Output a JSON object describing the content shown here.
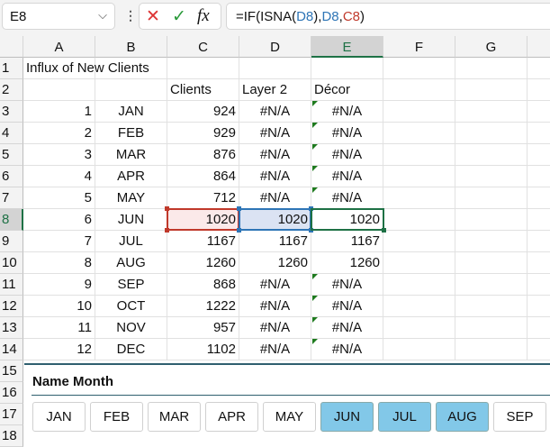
{
  "name_box": "E8",
  "formula": {
    "prefix": "=IF(ISNA(",
    "ref1": "D8",
    "mid1": "),",
    "ref2": "D8",
    "mid2": ",",
    "ref3": "C8",
    "suffix": ")"
  },
  "icons": {
    "cancel": "✕",
    "enter": "✓",
    "fx": "fx"
  },
  "columns": [
    "A",
    "B",
    "C",
    "D",
    "E",
    "F",
    "G"
  ],
  "selected_cell": "E8",
  "rows": [
    {
      "n": "1",
      "A": "Influx of New Clients"
    },
    {
      "n": "2",
      "C": "Clients",
      "D": "Layer 2",
      "E": "Décor"
    },
    {
      "n": "3",
      "A": "1",
      "B": "JAN",
      "C": "924",
      "D": "#N/A",
      "E": "#N/A"
    },
    {
      "n": "4",
      "A": "2",
      "B": "FEB",
      "C": "929",
      "D": "#N/A",
      "E": "#N/A"
    },
    {
      "n": "5",
      "A": "3",
      "B": "MAR",
      "C": "876",
      "D": "#N/A",
      "E": "#N/A"
    },
    {
      "n": "6",
      "A": "4",
      "B": "APR",
      "C": "864",
      "D": "#N/A",
      "E": "#N/A"
    },
    {
      "n": "7",
      "A": "5",
      "B": "MAY",
      "C": "712",
      "D": "#N/A",
      "E": "#N/A"
    },
    {
      "n": "8",
      "A": "6",
      "B": "JUN",
      "C": "1020",
      "D": "1020",
      "E": "1020"
    },
    {
      "n": "9",
      "A": "7",
      "B": "JUL",
      "C": "1167",
      "D": "1167",
      "E": "1167"
    },
    {
      "n": "10",
      "A": "8",
      "B": "AUG",
      "C": "1260",
      "D": "1260",
      "E": "1260"
    },
    {
      "n": "11",
      "A": "9",
      "B": "SEP",
      "C": "868",
      "D": "#N/A",
      "E": "#N/A"
    },
    {
      "n": "12",
      "A": "10",
      "B": "OCT",
      "C": "1222",
      "D": "#N/A",
      "E": "#N/A"
    },
    {
      "n": "13",
      "A": "11",
      "B": "NOV",
      "C": "957",
      "D": "#N/A",
      "E": "#N/A"
    },
    {
      "n": "14",
      "A": "12",
      "B": "DEC",
      "C": "1102",
      "D": "#N/A",
      "E": "#N/A"
    },
    {
      "n": "15"
    },
    {
      "n": "16"
    },
    {
      "n": "17"
    },
    {
      "n": "18"
    }
  ],
  "slicer": {
    "title": "Name Month",
    "items": [
      {
        "label": "JAN",
        "selected": false
      },
      {
        "label": "FEB",
        "selected": false
      },
      {
        "label": "MAR",
        "selected": false
      },
      {
        "label": "APR",
        "selected": false
      },
      {
        "label": "MAY",
        "selected": false
      },
      {
        "label": "JUN",
        "selected": true
      },
      {
        "label": "JUL",
        "selected": true
      },
      {
        "label": "AUG",
        "selected": true
      },
      {
        "label": "SEP",
        "selected": false
      }
    ]
  },
  "colors": {
    "accent": "#1e7145",
    "ref_red": "#c0392b",
    "ref_blue": "#2e75b6",
    "slicer_selected": "#82c8e8"
  }
}
